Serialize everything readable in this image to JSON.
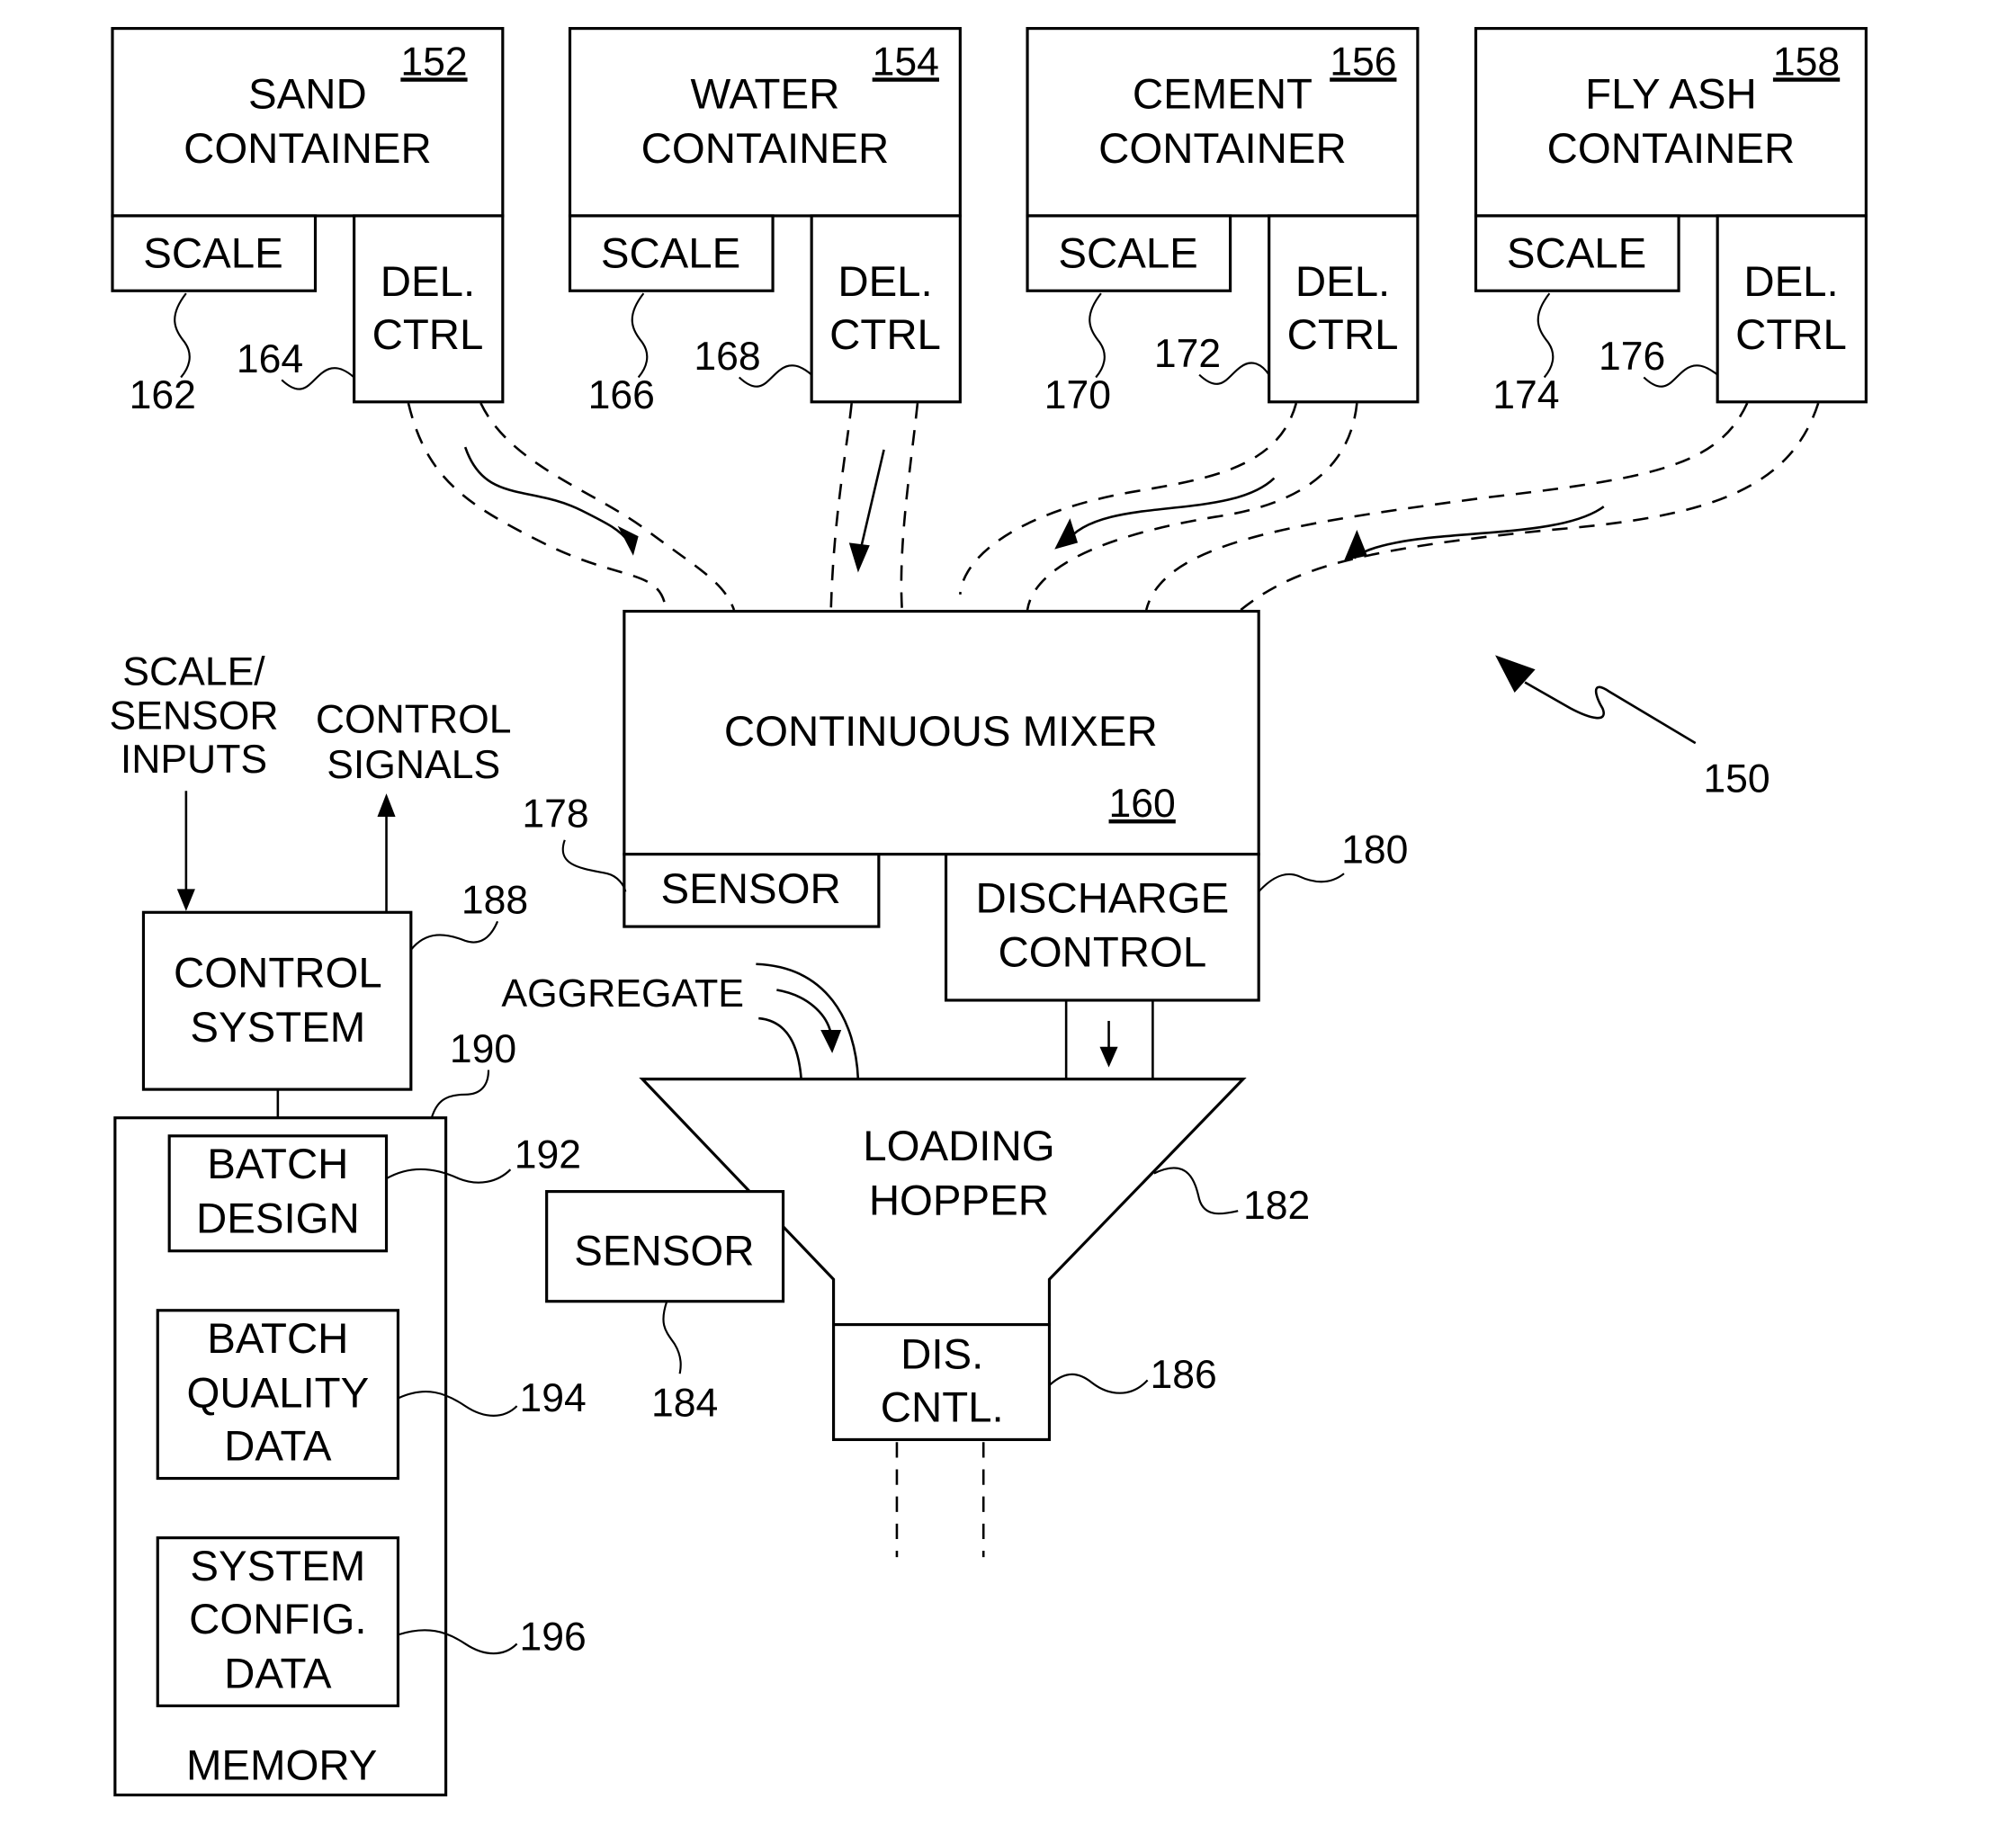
{
  "figure": {
    "ref": "150",
    "containers": [
      {
        "ref": "152",
        "line1": "SAND",
        "line2": "CONTAINER",
        "scale_label": "SCALE",
        "scale_ref": "162",
        "del_line1": "DEL.",
        "del_line2": "CTRL",
        "del_ref": "164"
      },
      {
        "ref": "154",
        "line1": "WATER",
        "line2": "CONTAINER",
        "scale_label": "SCALE",
        "scale_ref": "166",
        "del_line1": "DEL.",
        "del_line2": "CTRL",
        "del_ref": "168"
      },
      {
        "ref": "156",
        "line1": "CEMENT",
        "line2": "CONTAINER",
        "scale_label": "SCALE",
        "scale_ref": "170",
        "del_line1": "DEL.",
        "del_line2": "CTRL",
        "del_ref": "172"
      },
      {
        "ref": "158",
        "line1": "FLY ASH",
        "line2": "CONTAINER",
        "scale_label": "SCALE",
        "scale_ref": "174",
        "del_line1": "DEL.",
        "del_line2": "CTRL",
        "del_ref": "176"
      }
    ],
    "mixer": {
      "label": "CONTINUOUS MIXER",
      "ref": "160",
      "sensor_label": "SENSOR",
      "sensor_ref": "178",
      "discharge_line1": "DISCHARGE",
      "discharge_line2": "CONTROL",
      "discharge_ref": "180"
    },
    "hopper": {
      "line1": "LOADING",
      "line2": "HOPPER",
      "ref": "182",
      "aggregate_label": "AGGREGATE",
      "sensor_label": "SENSOR",
      "sensor_ref": "184",
      "dis_line1": "DIS.",
      "dis_line2": "CNTL.",
      "dis_ref": "186"
    },
    "control": {
      "line1": "CONTROL",
      "line2": "SYSTEM",
      "ref": "188",
      "inputs_line1": "SCALE/",
      "inputs_line2": "SENSOR",
      "inputs_line3": "INPUTS",
      "signals_line1": "CONTROL",
      "signals_line2": "SIGNALS"
    },
    "memory": {
      "label": "MEMORY",
      "ref": "190",
      "batch_design": {
        "line1": "BATCH",
        "line2": "DESIGN",
        "ref": "192"
      },
      "batch_quality": {
        "line1": "BATCH",
        "line2": "QUALITY",
        "line3": "DATA",
        "ref": "194"
      },
      "system_config": {
        "line1": "SYSTEM",
        "line2": "CONFIG.",
        "line3": "DATA",
        "ref": "196"
      }
    }
  }
}
